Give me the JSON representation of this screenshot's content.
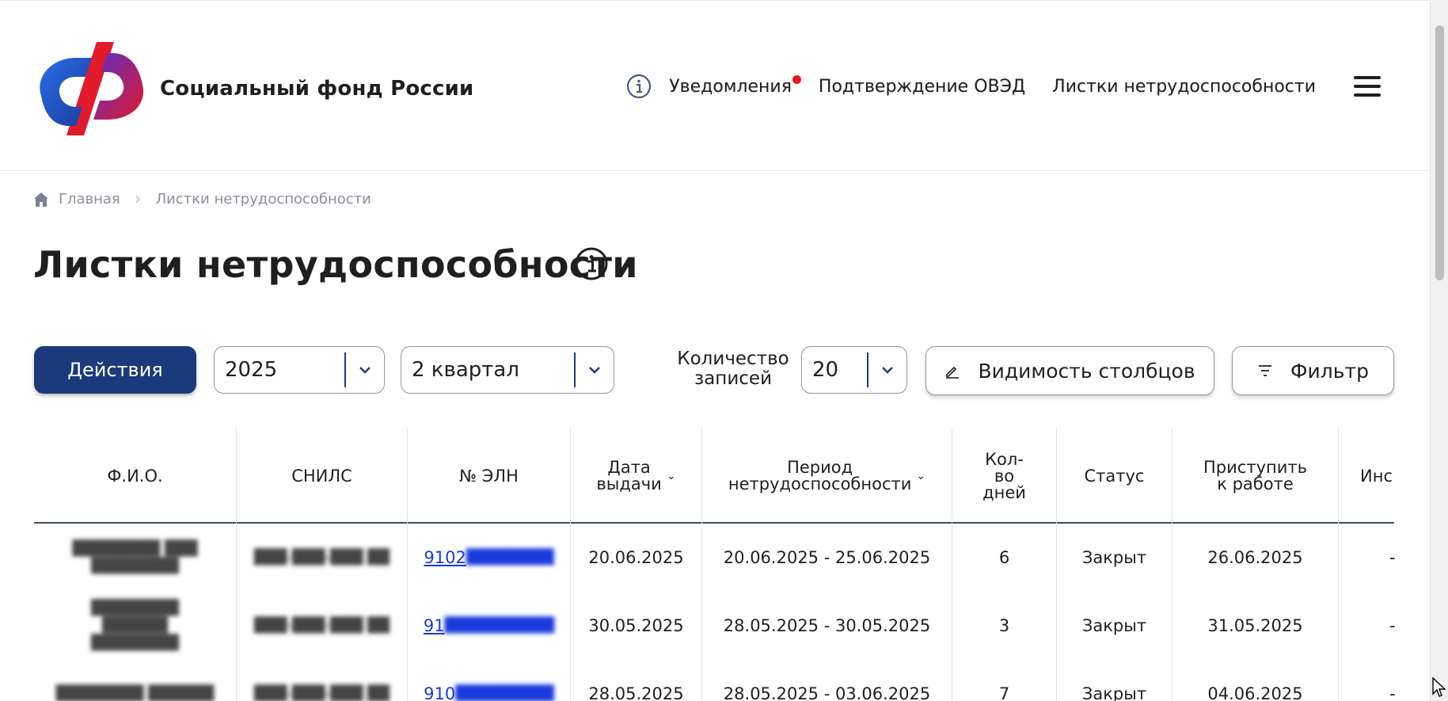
{
  "header": {
    "brand": "Социальный фонд России",
    "nav": [
      {
        "label": "Уведомления",
        "has_dot": true
      },
      {
        "label": "Подтверждение ОВЭД"
      },
      {
        "label": "Листки нетрудоспособности"
      }
    ],
    "icons": {
      "info": "info-icon",
      "menu": "hamburger-icon"
    },
    "colors": {
      "logo_blue": "#2a6ee6",
      "logo_red": "#e11a2c",
      "notification_dot": "#e8141e"
    }
  },
  "breadcrumb": {
    "home": "Главная",
    "current": "Листки нетрудоспособности"
  },
  "page_title": "Листки нетрудоспособности",
  "toolbar": {
    "actions_label": "Действия",
    "year": "2025",
    "quarter": "2 квартал",
    "count_label_line1": "Количество",
    "count_label_line2": "записей",
    "count": "20",
    "columns_label": "Видимость столбцов",
    "filter_label": "Фильтр",
    "colors": {
      "primary": "#1a3a7c"
    }
  },
  "table": {
    "headers": {
      "fio": "Ф.И.О.",
      "snils": "СНИЛС",
      "eln": "№ ЭЛН",
      "date_l1": "Дата",
      "date_l2": "выдачи",
      "period_l1": "Период",
      "period_l2": "нетрудоспособности",
      "days_l1": "Кол-",
      "days_l2": "во",
      "days_l3": "дней",
      "status": "Статус",
      "return_l1": "Приступить",
      "return_l2": "к работе",
      "extra": "Инс"
    },
    "rows": [
      {
        "fio": "████████ ███ ████████",
        "snils": "███-███-███ ██",
        "eln_prefix": "9102",
        "eln_rest": "████████",
        "date": "20.06.2025",
        "period": "20.06.2025 - 25.06.2025",
        "days": "6",
        "status": "Закрыт",
        "return": "26.06.2025",
        "extra": "-"
      },
      {
        "fio": "████████ ██████ ████████",
        "snils": "███-███-███ ██",
        "eln_prefix": "91",
        "eln_rest": "██████████",
        "date": "30.05.2025",
        "period": "28.05.2025 - 30.05.2025",
        "days": "3",
        "status": "Закрыт",
        "return": "31.05.2025",
        "extra": "-"
      },
      {
        "fio": "████████ ██████",
        "snils": "███-███-███ ██",
        "eln_prefix": "910",
        "eln_rest": "█████████",
        "date": "28.05.2025",
        "period": "28.05.2025 - 03.06.2025",
        "days": "7",
        "status": "Закрыт",
        "return": "04.06.2025",
        "extra": "-"
      }
    ]
  }
}
